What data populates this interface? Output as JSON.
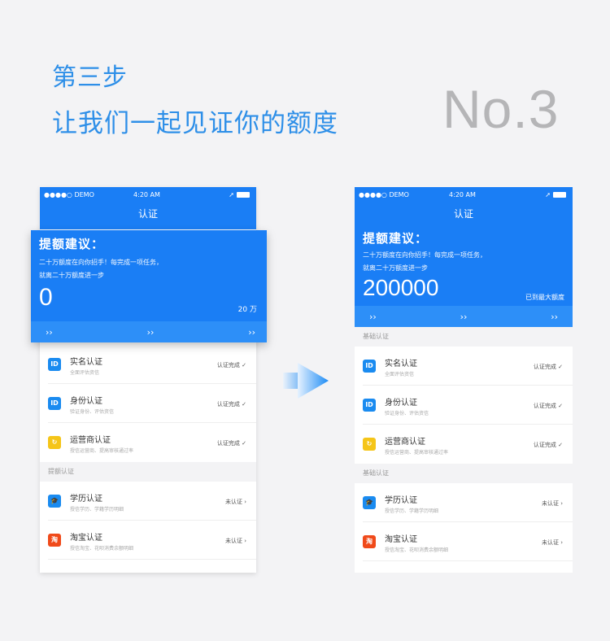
{
  "header": {
    "step": "第三步",
    "subtitle": "让我们一起见证你的额度",
    "number": "No.3"
  },
  "phone": {
    "status_signal": "●●●●○ DEMO",
    "status_time": "4:20 AM",
    "nav_title": "认证"
  },
  "hero": {
    "title": "提额建议：",
    "desc_line1": "二十万额度在向你招手！每完成一项任务，",
    "desc_line2": "就离二十万额度进一步",
    "left_amount": "0",
    "left_max": "20 万",
    "right_amount": "200000",
    "right_max": "已到最大额度",
    "chevron": "››"
  },
  "sections": {
    "basic": "基础认证",
    "boost": "提额认证"
  },
  "items": [
    {
      "title": "实名认证",
      "desc": "全面评估资信",
      "status": "认证完成 ✓",
      "icon_label": "ID"
    },
    {
      "title": "身份认证",
      "desc": "验证身份、评估资信",
      "status": "认证完成 ✓",
      "icon_label": "ID"
    },
    {
      "title": "运营商认证",
      "desc": "授信运营商、提高审核通过率",
      "status": "认证完成 ✓",
      "icon_label": "↻"
    },
    {
      "title": "学历认证",
      "desc": "授信学历、学籍学历明细",
      "status": "未认证 ›",
      "icon_label": "🎓"
    },
    {
      "title": "淘宝认证",
      "desc": "授信淘宝、花呗消费余额明细",
      "status": "未认证 ›",
      "icon_label": "淘"
    }
  ],
  "colors": {
    "primary": "#1a7ef5",
    "heading": "#2e8fe8",
    "number": "#b5b5b7"
  }
}
